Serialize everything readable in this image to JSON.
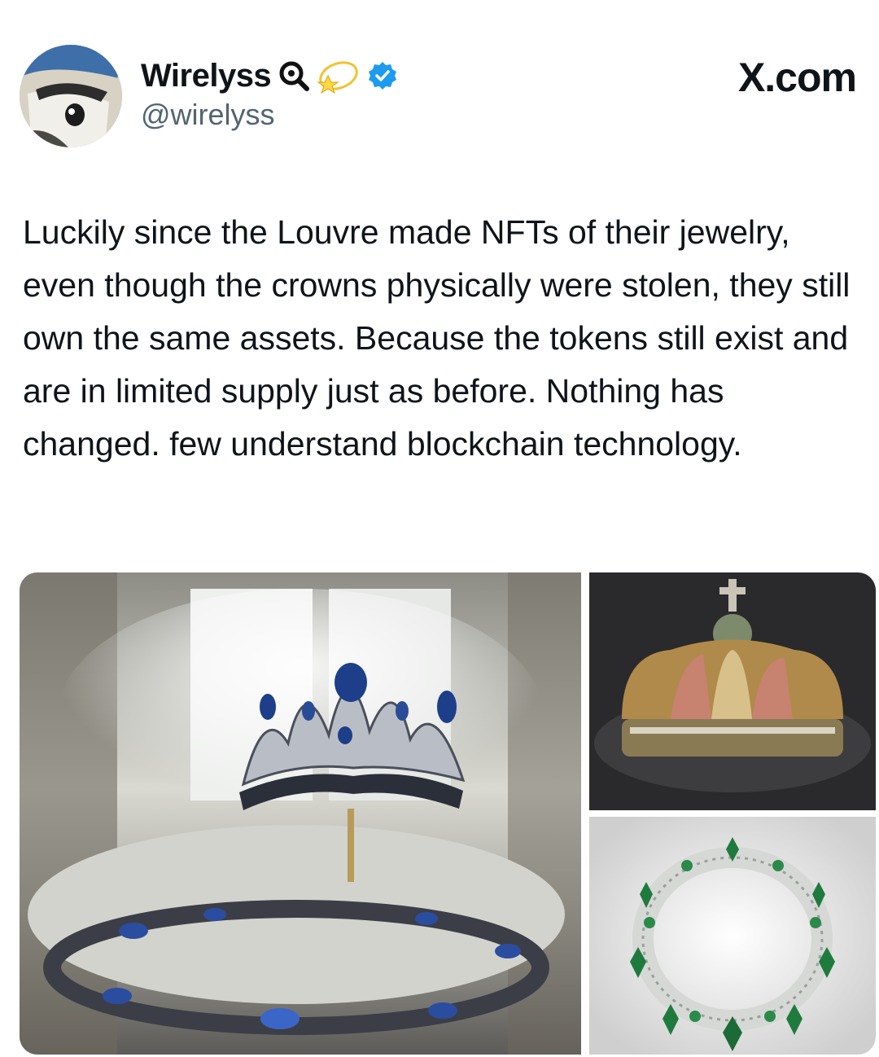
{
  "author": {
    "display_name": "Wirelyss",
    "handle": "@wirelyss",
    "verified": true
  },
  "brand": "X.com",
  "tweet": {
    "text": "Luckily since the Louvre made NFTs of their jewelry, even though the crowns physically were stolen, they still own the same assets. Because the tokens still exist and are in limited supply just as before. Nothing has changed. few understand blockchain technology."
  },
  "colors": {
    "verified_badge": "#1d9bf0",
    "text": "#0f1419",
    "secondary_text": "#536471"
  },
  "icons": [
    "magnifier-emoji-icon",
    "halo-emoji-icon",
    "verified-badge-icon"
  ]
}
